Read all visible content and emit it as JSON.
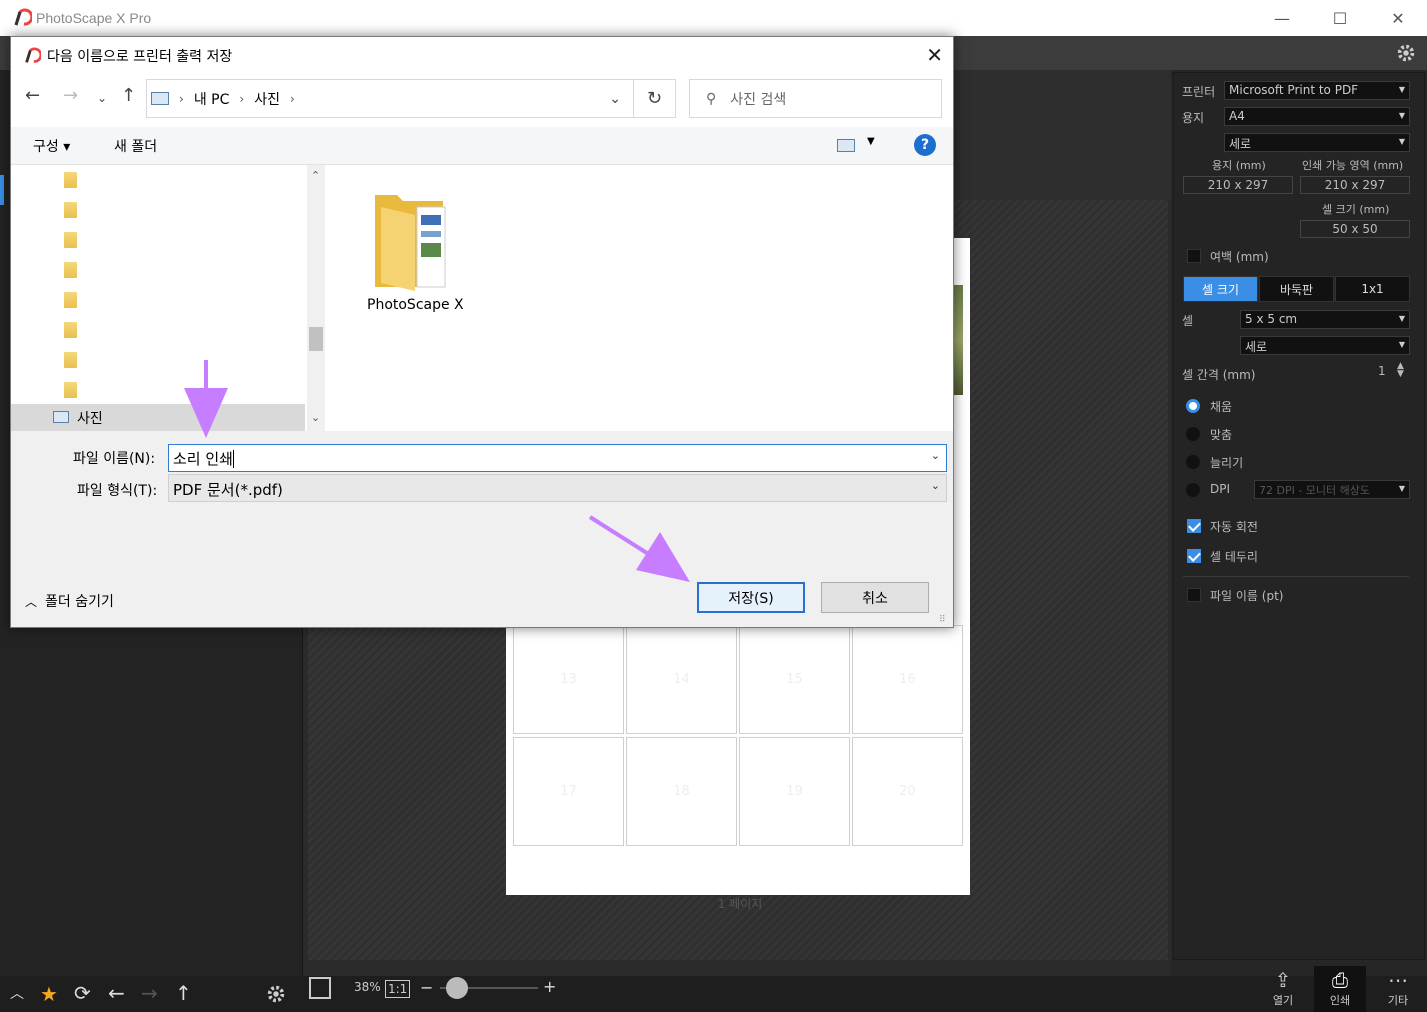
{
  "app": {
    "title": "PhotoScape X Pro",
    "controls": {
      "minimize": "—",
      "maximize": "☐",
      "close": "✕"
    }
  },
  "dialog": {
    "title": "다음 이름으로 프린터 출력 저장",
    "breadcrumb": [
      "내 PC",
      "사진"
    ],
    "search_placeholder": "사진 검색",
    "organize_label": "구성 ▾",
    "new_folder_label": "새 폴더",
    "help_label": "?",
    "tree_selected_label": "사진",
    "folder_item": "PhotoScape X",
    "filename_label": "파일 이름(N):",
    "filename_value": "소리 인쇄",
    "filetype_label": "파일 형식(T):",
    "filetype_value": "PDF 문서(*.pdf)",
    "save_label": "저장(S)",
    "cancel_label": "취소",
    "hide_folders_label": "폴더 숨기기"
  },
  "print_panel": {
    "printer_label": "프린터",
    "printer_value": "Microsoft Print to PDF",
    "paper_label": "용지",
    "paper_value": "A4",
    "orientation_value": "세로",
    "paper_mm_label": "용지 (mm)",
    "printable_label": "인쇄 가능 영역 (mm)",
    "paper_mm_value": "210 x 297",
    "printable_value": "210 x 297",
    "cell_size_label": "셀 크기 (mm)",
    "cell_size_value": "50 x 50",
    "margin_label": "여백 (mm)",
    "tabs": [
      "셀 크기",
      "바둑판",
      "1x1"
    ],
    "cell_label": "셀",
    "cell_value": "5 x 5 cm",
    "cell_orientation": "세로",
    "cell_gap_label": "셀 간격 (mm)",
    "cell_gap_value": "1",
    "fill_label": "채움",
    "fit_label": "맞춤",
    "stretch_label": "늘리기",
    "dpi_label": "DPI",
    "dpi_value": "72 DPI - 모니터 해상도",
    "auto_rotate_label": "자동 회전",
    "cell_border_label": "셀 테두리",
    "filename_pt_label": "파일 이름 (pt)"
  },
  "canvas": {
    "cells": [
      "13",
      "14",
      "15",
      "16",
      "17",
      "18",
      "19",
      "20"
    ],
    "page_label": "1 페이지"
  },
  "bottom": {
    "zoom": "38%",
    "one_to_one": "1:1",
    "open_label": "열기",
    "print_label": "인쇄",
    "more_label": "기타"
  },
  "colors": {
    "accent": "#3a8ee6",
    "arrow": "#c77dff"
  }
}
